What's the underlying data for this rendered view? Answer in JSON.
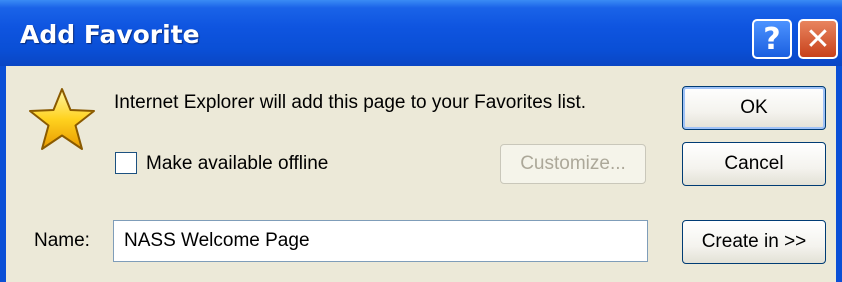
{
  "window": {
    "title": "Add Favorite",
    "help_glyph": "?",
    "close_glyph": "✕",
    "title_bar_color": "#0a4fd6"
  },
  "icon": {
    "name": "favorites-star-icon",
    "color": "#ffd21f"
  },
  "message": "Internet Explorer will add this page to your Favorites list.",
  "offline": {
    "label": "Make available offline",
    "checked": false
  },
  "buttons": {
    "ok": "OK",
    "cancel": "Cancel",
    "customize": "Customize...",
    "create_in": "Create in >>"
  },
  "name_field": {
    "label": "Name:",
    "value": "NASS Welcome Page"
  }
}
